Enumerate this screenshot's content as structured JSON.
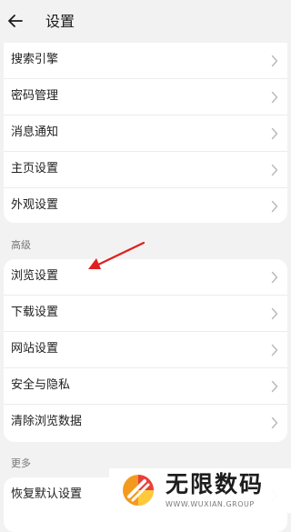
{
  "header": {
    "title": "设置"
  },
  "general": {
    "items": [
      {
        "label": "搜索引擎"
      },
      {
        "label": "密码管理"
      },
      {
        "label": "消息通知"
      },
      {
        "label": "主页设置"
      },
      {
        "label": "外观设置"
      }
    ]
  },
  "advanced": {
    "title": "高级",
    "items": [
      {
        "label": "浏览设置"
      },
      {
        "label": "下载设置"
      },
      {
        "label": "网站设置"
      },
      {
        "label": "安全与隐私"
      },
      {
        "label": "清除浏览数据"
      }
    ]
  },
  "more": {
    "title": "更多",
    "items": [
      {
        "label": "恢复默认设置"
      }
    ]
  },
  "annotation": {
    "color": "#e02020"
  },
  "watermark": {
    "brand": "无限数码",
    "url": "WWW.WUXIAN.GROUP"
  },
  "icons": {
    "back": "back-arrow-icon",
    "chevron": "chevron-right-icon"
  }
}
